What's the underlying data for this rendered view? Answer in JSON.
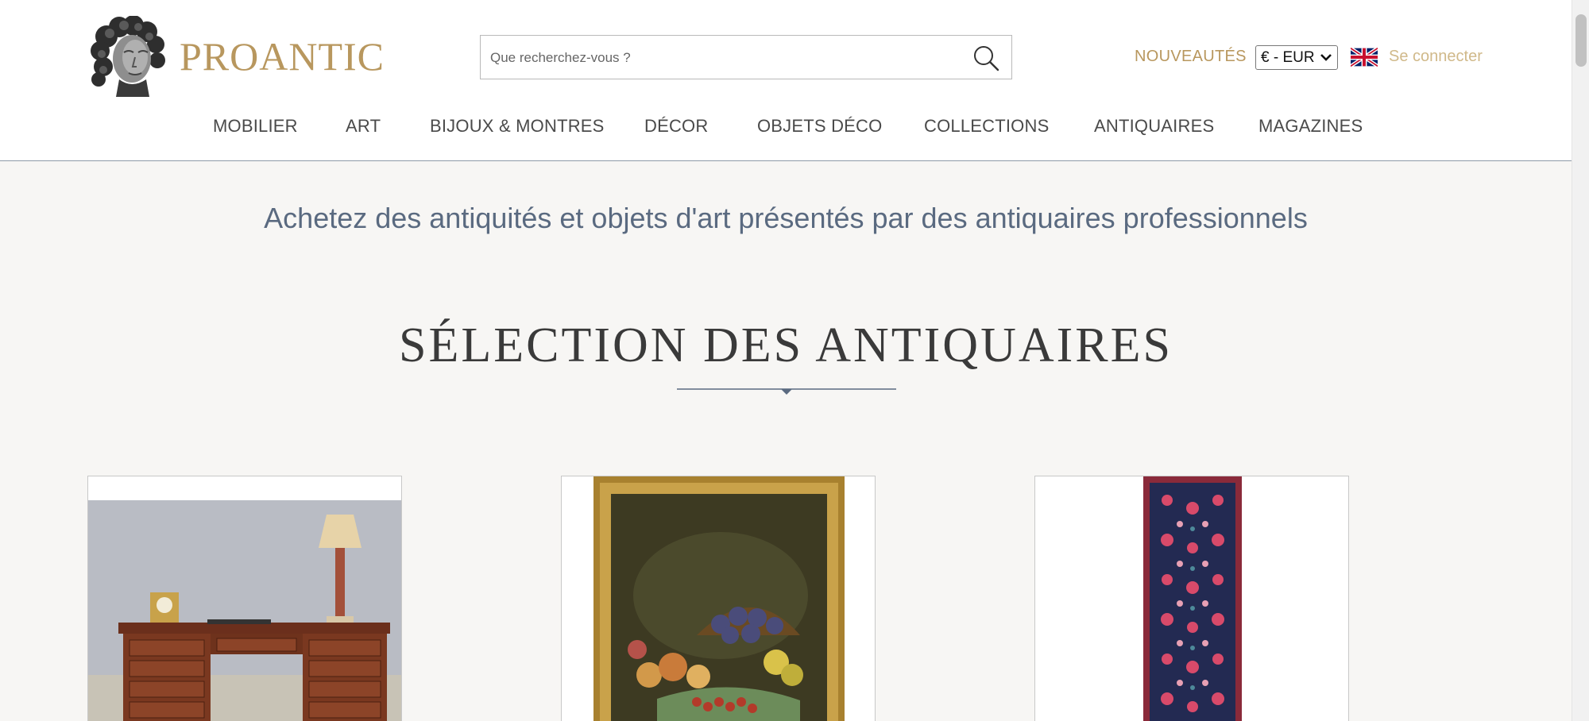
{
  "header": {
    "logo_text": "PROANTIC",
    "search": {
      "placeholder": "Que recherchez-vous ?"
    },
    "new_label": "NOUVEAUTÉS",
    "currency": "€ - EUR",
    "login_label": "Se connecter"
  },
  "nav": {
    "items": [
      {
        "label": "MOBILIER"
      },
      {
        "label": "ART"
      },
      {
        "label": "BIJOUX & MONTRES"
      },
      {
        "label": "DÉCOR"
      },
      {
        "label": "OBJETS DÉCO"
      },
      {
        "label": "COLLECTIONS"
      },
      {
        "label": "ANTIQUAIRES"
      },
      {
        "label": "MAGAZINES"
      }
    ]
  },
  "main": {
    "tagline": "Achetez des antiquités et objets d'art présentés par des antiquaires professionnels",
    "section_title": "SÉLECTION DES ANTIQUAIRES",
    "cards": [
      {
        "image": "desk-with-lamp-and-clock"
      },
      {
        "image": "framed-still-life-fruit-painting"
      },
      {
        "image": "persian-runner-rug"
      }
    ]
  },
  "colors": {
    "gold": "#b8975e",
    "gold_light": "#d0b98a",
    "slate": "#5a6a80",
    "background": "#f7f6f4"
  },
  "icons": [
    "bust-logo-icon",
    "search-icon",
    "chevron-down-icon",
    "uk-flag-icon",
    "divider-diamond-icon"
  ]
}
